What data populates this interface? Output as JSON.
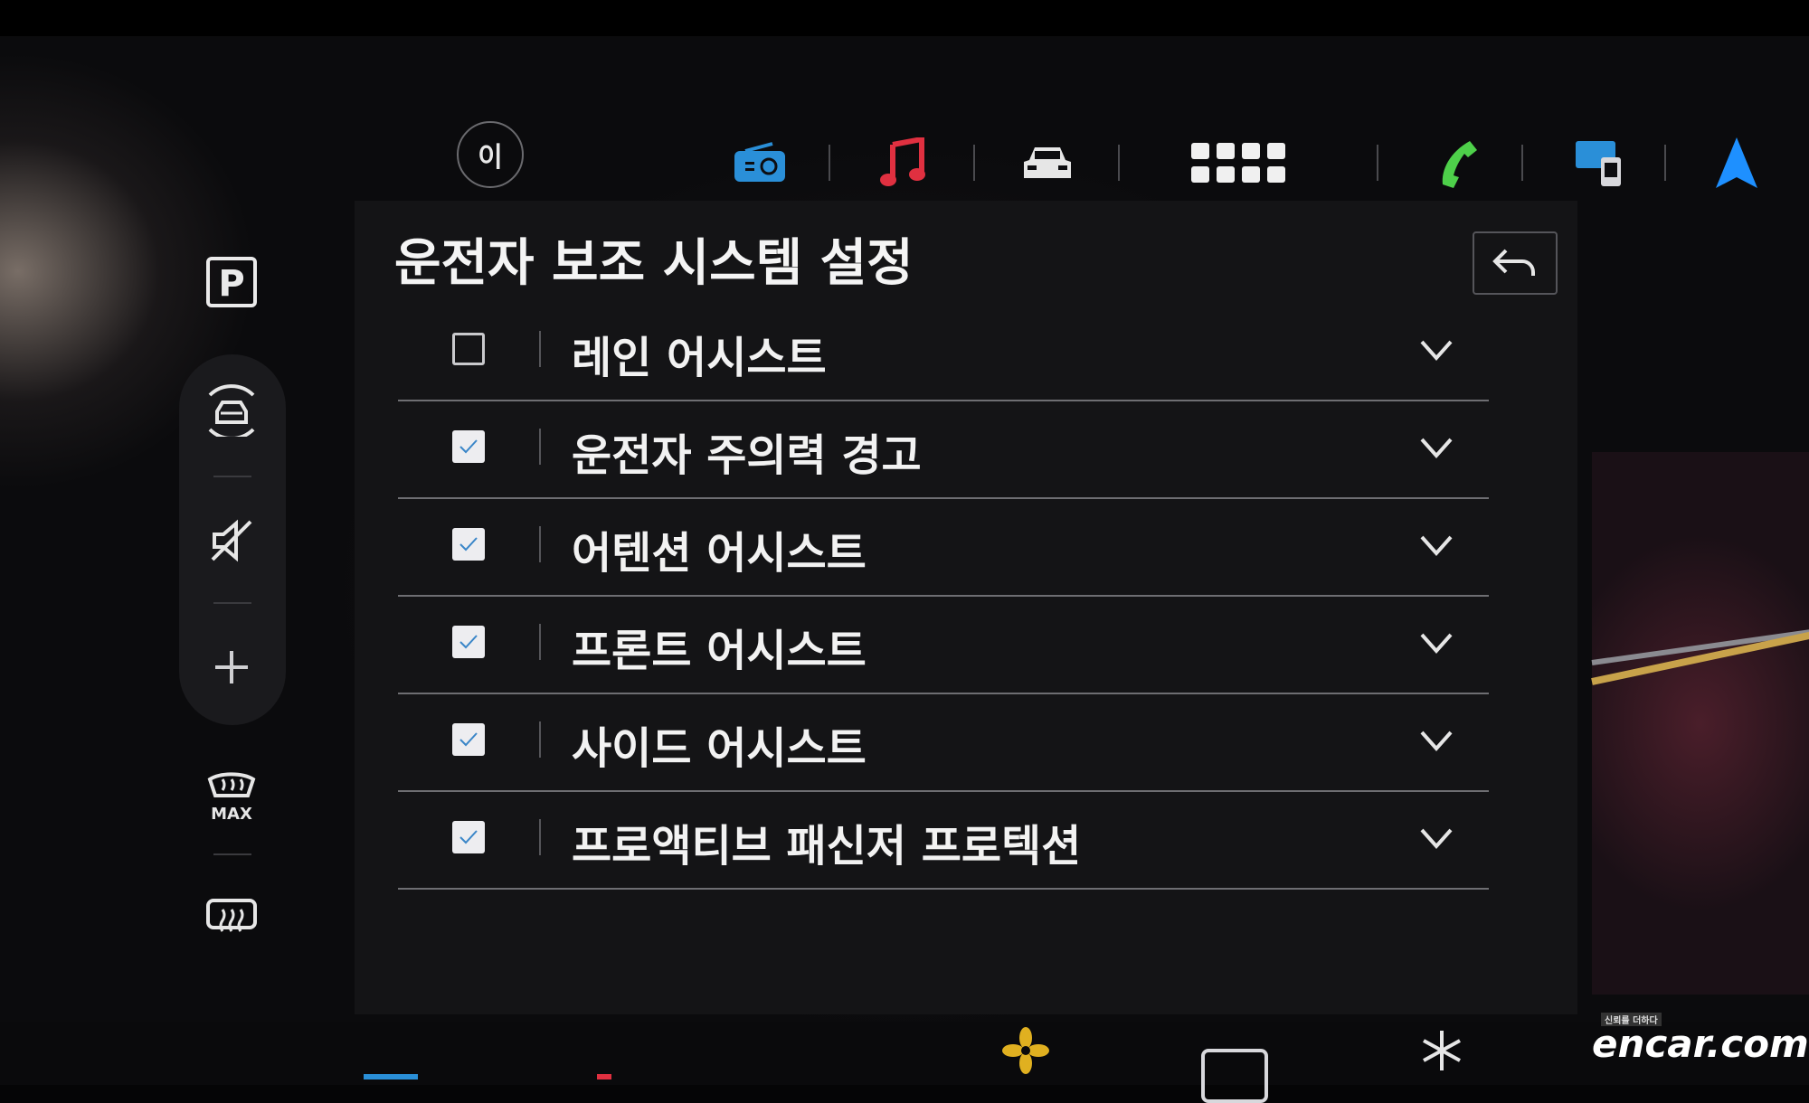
{
  "profile": {
    "initial": "이"
  },
  "topbar": {
    "icons": [
      "radio-icon",
      "music-icon",
      "car-icon",
      "apps-grid-icon",
      "phone-icon",
      "device-icon",
      "navigation-icon"
    ],
    "colors": {
      "radio": "#2a8fd8",
      "music": "#e03040",
      "car": "#e6e6e6",
      "apps": "#f0f0f0",
      "phone": "#4ed04a",
      "device": "#2a8fd8",
      "navigation": "#1e90ff"
    }
  },
  "sidebar": {
    "icons": [
      "parking-icon",
      "driver-assist-icon",
      "mute-icon",
      "add-icon",
      "max-defrost-icon",
      "rear-defrost-icon"
    ],
    "max_label": "MAX"
  },
  "panel": {
    "title": "운전자 보조 시스템 설정",
    "back_label": "back",
    "items": [
      {
        "label": "레인 어시스트",
        "checked": false
      },
      {
        "label": "운전자 주의력 경고",
        "checked": true
      },
      {
        "label": "어텐션 어시스트",
        "checked": true
      },
      {
        "label": "프론트 어시스트",
        "checked": true
      },
      {
        "label": "사이드 어시스트",
        "checked": true
      },
      {
        "label": "프로액티브 패신저 프로텍션",
        "checked": true
      }
    ]
  },
  "watermark": {
    "brand": "encar.com",
    "tagline": "신뢰를 더하다"
  }
}
